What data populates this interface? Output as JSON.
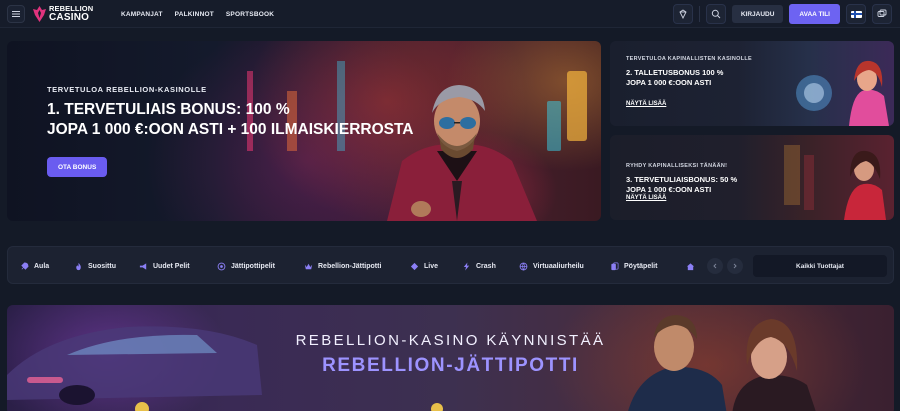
{
  "header": {
    "logo": {
      "line1": "REBELLION",
      "line2": "CASINO"
    },
    "nav": [
      "KAMPANJAT",
      "PALKINNOT",
      "SPORTSBOOK"
    ],
    "login_label": "KIRJAUDU",
    "signup_label": "AVAA TILI",
    "accent_color": "#6d63f2"
  },
  "hero": {
    "kicker": "TERVETULOA REBELLION-KASINOLLE",
    "title_line1": "1. TERVETULIAIS BONUS: 100 %",
    "title_line2": "JOPA 1 000 €:OON ASTI + 100 ILMAISKIERROSTA",
    "cta_label": "OTA BONUS"
  },
  "promos": [
    {
      "kicker": "TERVETULOA KAPINALLISTEN KASINOLLE",
      "title_line1": "2. TALLETUSBONUS 100 %",
      "title_line2": "JOPA 1 000 €:OON ASTI",
      "link_label": "NÄYTÄ LISÄÄ"
    },
    {
      "kicker": "RYHDY KAPINALLISEKSI TÄNÄÄN!",
      "title_line1": "3. TERVETULIAISBONUS: 50 %",
      "title_line2": "JOPA 1 000 €:OON ASTI",
      "link_label": "NÄYTÄ LISÄÄ"
    }
  ],
  "categories": [
    {
      "label": "Aula",
      "icon": "rocket-icon"
    },
    {
      "label": "Suosittu",
      "icon": "flame-icon"
    },
    {
      "label": "Uudet Pelit",
      "icon": "megaphone-icon"
    },
    {
      "label": "Jättipottipelit",
      "icon": "coin-stack-icon"
    },
    {
      "label": "Rebellion-Jättipotti",
      "icon": "crown-icon"
    },
    {
      "label": "Live",
      "icon": "live-icon"
    },
    {
      "label": "Crash",
      "icon": "bolt-icon"
    },
    {
      "label": "Virtuaaliurheilu",
      "icon": "globe-icon"
    },
    {
      "label": "Pöytäpelit",
      "icon": "cards-icon"
    }
  ],
  "providers_label": "Kaikki Tuottajat",
  "banner": {
    "line1": "REBELLION-KASINO KÄYNNISTÄÄ",
    "line2": "REBELLION-JÄTTIPOTTI"
  }
}
